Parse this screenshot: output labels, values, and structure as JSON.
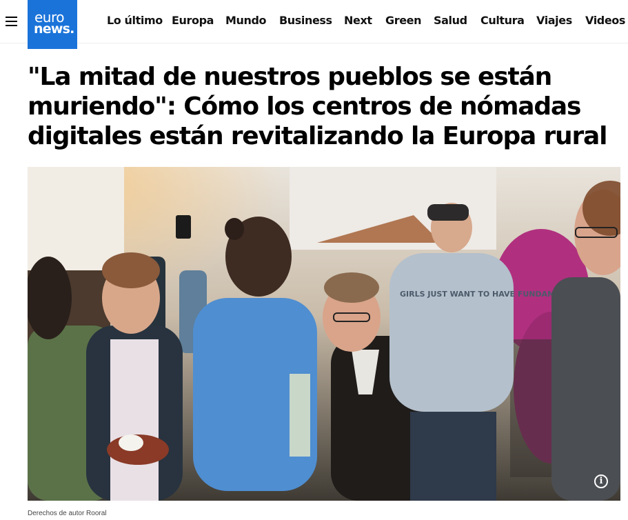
{
  "header": {
    "logo": {
      "line1": "euro",
      "line2": "news."
    },
    "nav": [
      {
        "label": "Lo último"
      },
      {
        "label": "Europa"
      },
      {
        "label": "Mundo"
      },
      {
        "label": "Business"
      },
      {
        "label": "Next"
      },
      {
        "label": "Green"
      },
      {
        "label": "Salud"
      },
      {
        "label": "Cultura"
      },
      {
        "label": "Viajes"
      },
      {
        "label": "Videos"
      }
    ]
  },
  "article": {
    "title": "\"La mitad de nuestros pueblos se están muriendo\": Cómo los centros de nómadas digitales están revitalizando la Europa rural",
    "image": {
      "info_symbol": "i",
      "caption": "Derechos de autor Rooral",
      "sweatshirt_text": "GIRLS JUST WANT TO HAVE FUNDAMENTAL RIGHTS"
    }
  },
  "colors": {
    "brand_blue": "#1a73d9",
    "text": "#000000"
  },
  "icons": [
    "hamburger-menu-icon",
    "info-icon"
  ]
}
